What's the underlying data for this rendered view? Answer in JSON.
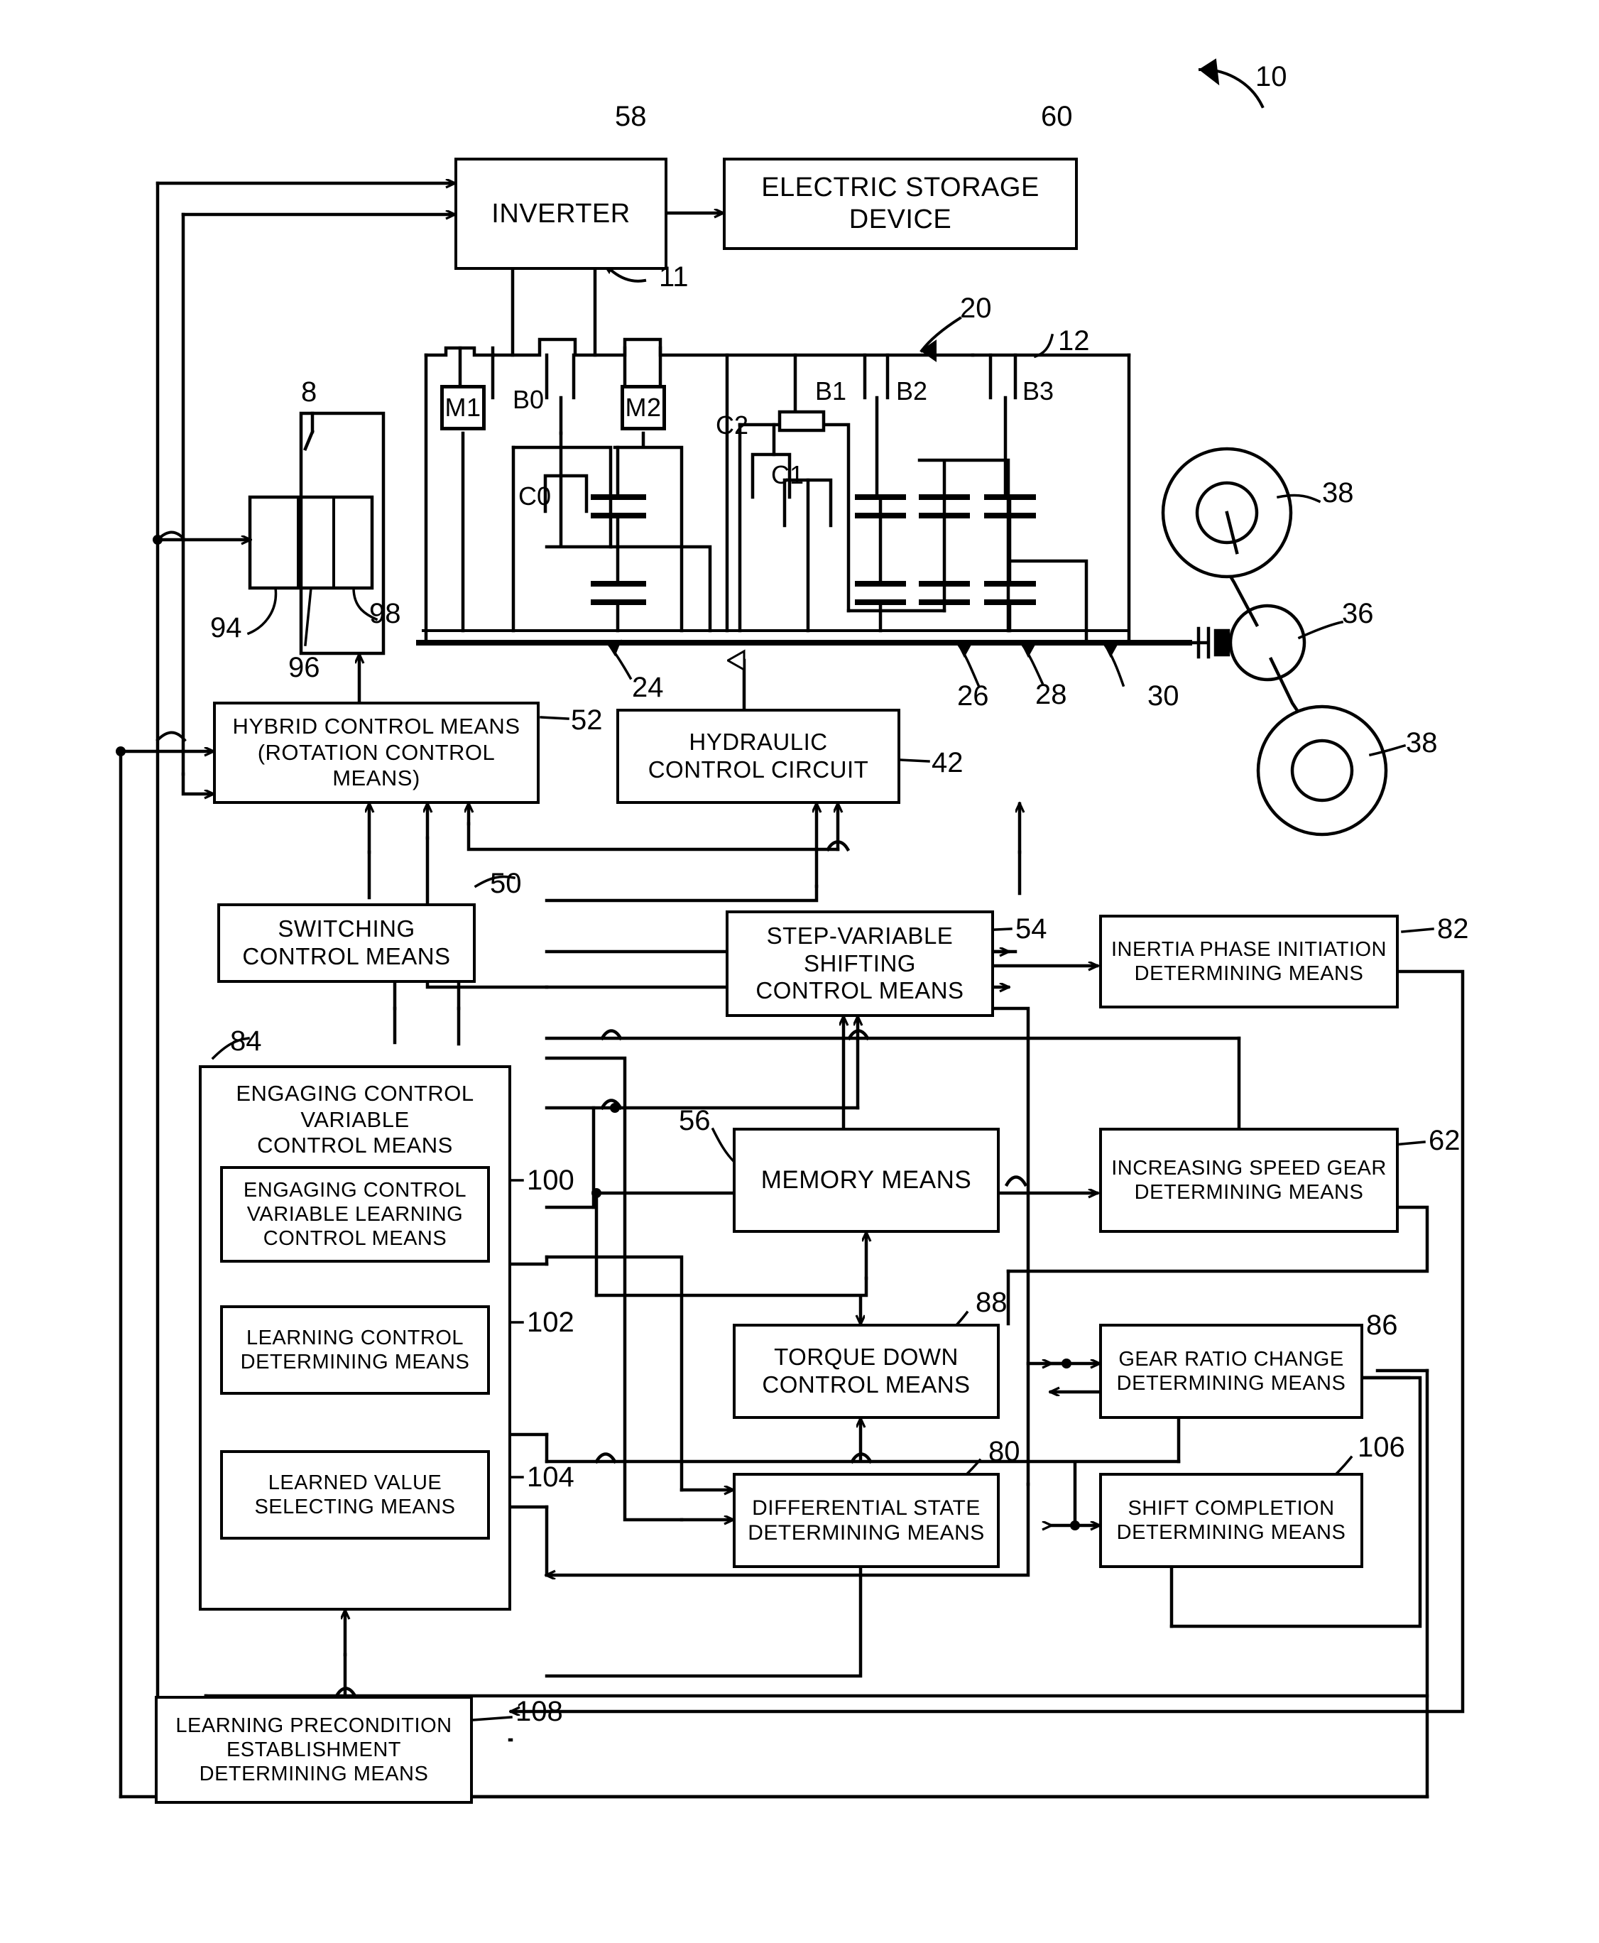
{
  "figure": {
    "reference_numeral": "10",
    "type": "hybrid vehicle drive control block diagram"
  },
  "top_blocks": [
    {
      "id": "inverter",
      "label": "INVERTER",
      "ref": "58"
    },
    {
      "id": "storage",
      "label": "ELECTRIC STORAGE DEVICE",
      "ref": "60"
    }
  ],
  "mechanical": {
    "ref_drive_unit": "11",
    "ref_transmission_group": "20",
    "ref_casing": "12",
    "ref_engine": "8",
    "engine_parts": [
      "94",
      "96",
      "98"
    ],
    "ref_input_shaft": "24",
    "ref_planetary_sets": [
      "26",
      "28",
      "30"
    ],
    "ref_differential": "36",
    "ref_wheels": "38",
    "motors": [
      "M1",
      "M2"
    ],
    "clutches": [
      "C0",
      "C1",
      "C2"
    ],
    "brakes": [
      "B0",
      "B1",
      "B2",
      "B3"
    ]
  },
  "control_blocks": [
    {
      "id": "hybrid",
      "label": "HYBRID CONTROL MEANS\n(ROTATION CONTROL\nMEANS)",
      "ref": "52"
    },
    {
      "id": "hydraulic",
      "label": "HYDRAULIC\nCONTROL CIRCUIT",
      "ref": "42"
    },
    {
      "id": "switching",
      "label": "SWITCHING\nCONTROL MEANS",
      "ref": "50"
    },
    {
      "id": "stepvar",
      "label": "STEP-VARIABLE\nSHIFTING\nCONTROL MEANS",
      "ref": "54"
    },
    {
      "id": "inertia",
      "label": "INERTIA PHASE INITIATION\nDETERMINING MEANS",
      "ref": "82"
    },
    {
      "id": "engaging",
      "label": "ENGAGING CONTROL\nVARIABLE\nCONTROL MEANS",
      "ref": "84"
    },
    {
      "id": "ecvlearn",
      "label": "ENGAGING CONTROL\nVARIABLE LEARNING\nCONTROL MEANS",
      "ref": "100"
    },
    {
      "id": "learndet",
      "label": "LEARNING CONTROL\nDETERMINING MEANS",
      "ref": "102"
    },
    {
      "id": "learnsel",
      "label": "LEARNED VALUE\nSELECTING MEANS",
      "ref": "104"
    },
    {
      "id": "memory",
      "label": "MEMORY MEANS",
      "ref": "56"
    },
    {
      "id": "incspeed",
      "label": "INCREASING SPEED GEAR\nDETERMINING MEANS",
      "ref": "62"
    },
    {
      "id": "torquedown",
      "label": "TORQUE DOWN\nCONTROL MEANS",
      "ref": "88"
    },
    {
      "id": "gearratio",
      "label": "GEAR RATIO CHANGE\nDETERMINING MEANS",
      "ref": "86"
    },
    {
      "id": "diffstate",
      "label": "DIFFERENTIAL STATE\nDETERMINING MEANS",
      "ref": "80"
    },
    {
      "id": "shiftcomp",
      "label": "SHIFT COMPLETION\nDETERMINING MEANS",
      "ref": "106"
    },
    {
      "id": "learnprecond",
      "label": "LEARNING PRECONDITION\nESTABLISHMENT\nDETERMINING MEANS",
      "ref": "108"
    }
  ],
  "colors": {
    "line": "#000000",
    "background": "#ffffff"
  }
}
